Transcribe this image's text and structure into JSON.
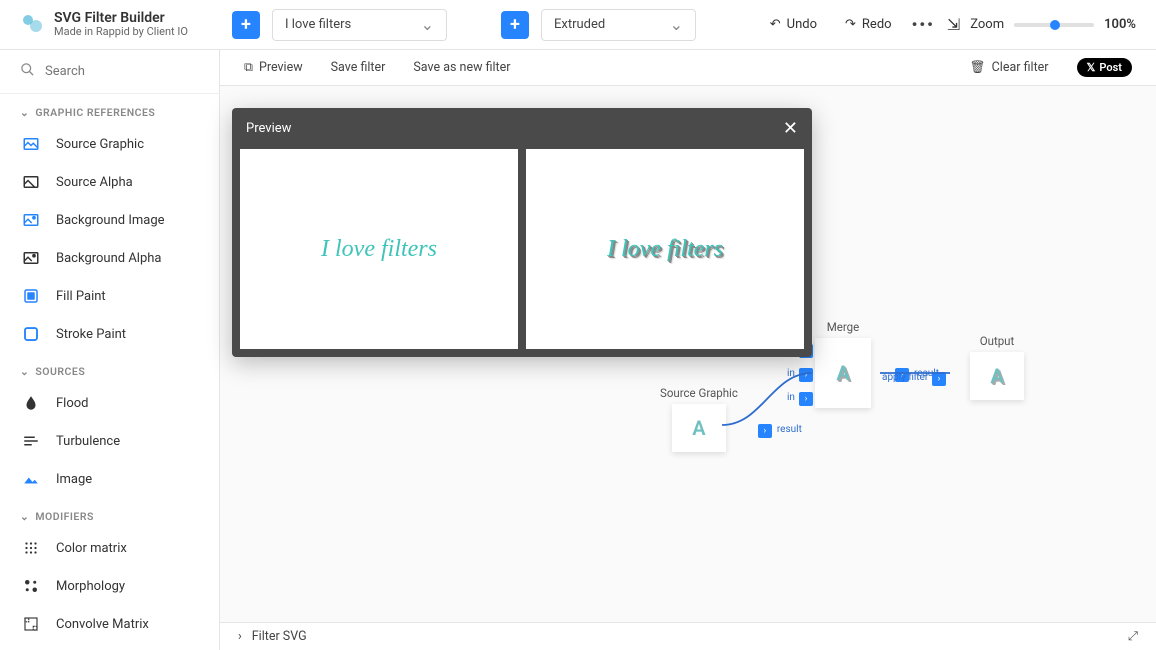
{
  "app": {
    "title": "SVG Filter Builder",
    "subtitle": "Made in Rappid by Client IO"
  },
  "header": {
    "dropdown1": "I love filters",
    "dropdown2": "Extruded",
    "undo": "Undo",
    "redo": "Redo",
    "zoom_label": "Zoom",
    "zoom_value": "100%"
  },
  "sidebar": {
    "search_placeholder": "Search",
    "sections": {
      "graphic_refs": {
        "title": "GRAPHIC REFERENCES",
        "items": [
          {
            "label": "Source Graphic"
          },
          {
            "label": "Source Alpha"
          },
          {
            "label": "Background Image"
          },
          {
            "label": "Background Alpha"
          },
          {
            "label": "Fill Paint"
          },
          {
            "label": "Stroke Paint"
          }
        ]
      },
      "sources": {
        "title": "SOURCES",
        "items": [
          {
            "label": "Flood"
          },
          {
            "label": "Turbulence"
          },
          {
            "label": "Image"
          }
        ]
      },
      "modifiers": {
        "title": "MODIFIERS",
        "items": [
          {
            "label": "Color matrix"
          },
          {
            "label": "Morphology"
          },
          {
            "label": "Convolve Matrix"
          }
        ]
      }
    }
  },
  "subbar": {
    "preview": "Preview",
    "save": "Save filter",
    "save_as": "Save as new filter",
    "clear": "Clear filter",
    "post": "Post"
  },
  "modal": {
    "title": "Preview",
    "sample_text": "I love filters"
  },
  "nodes": {
    "source_graphic": {
      "label": "Source Graphic",
      "letter": "A",
      "port_out": "result"
    },
    "merge": {
      "label": "Merge",
      "letter": "A",
      "port_in": "in",
      "port_out": "result"
    },
    "output": {
      "label": "Output",
      "letter": "A",
      "port_in": "apply filter"
    }
  },
  "bottom": {
    "title": "Filter SVG"
  }
}
